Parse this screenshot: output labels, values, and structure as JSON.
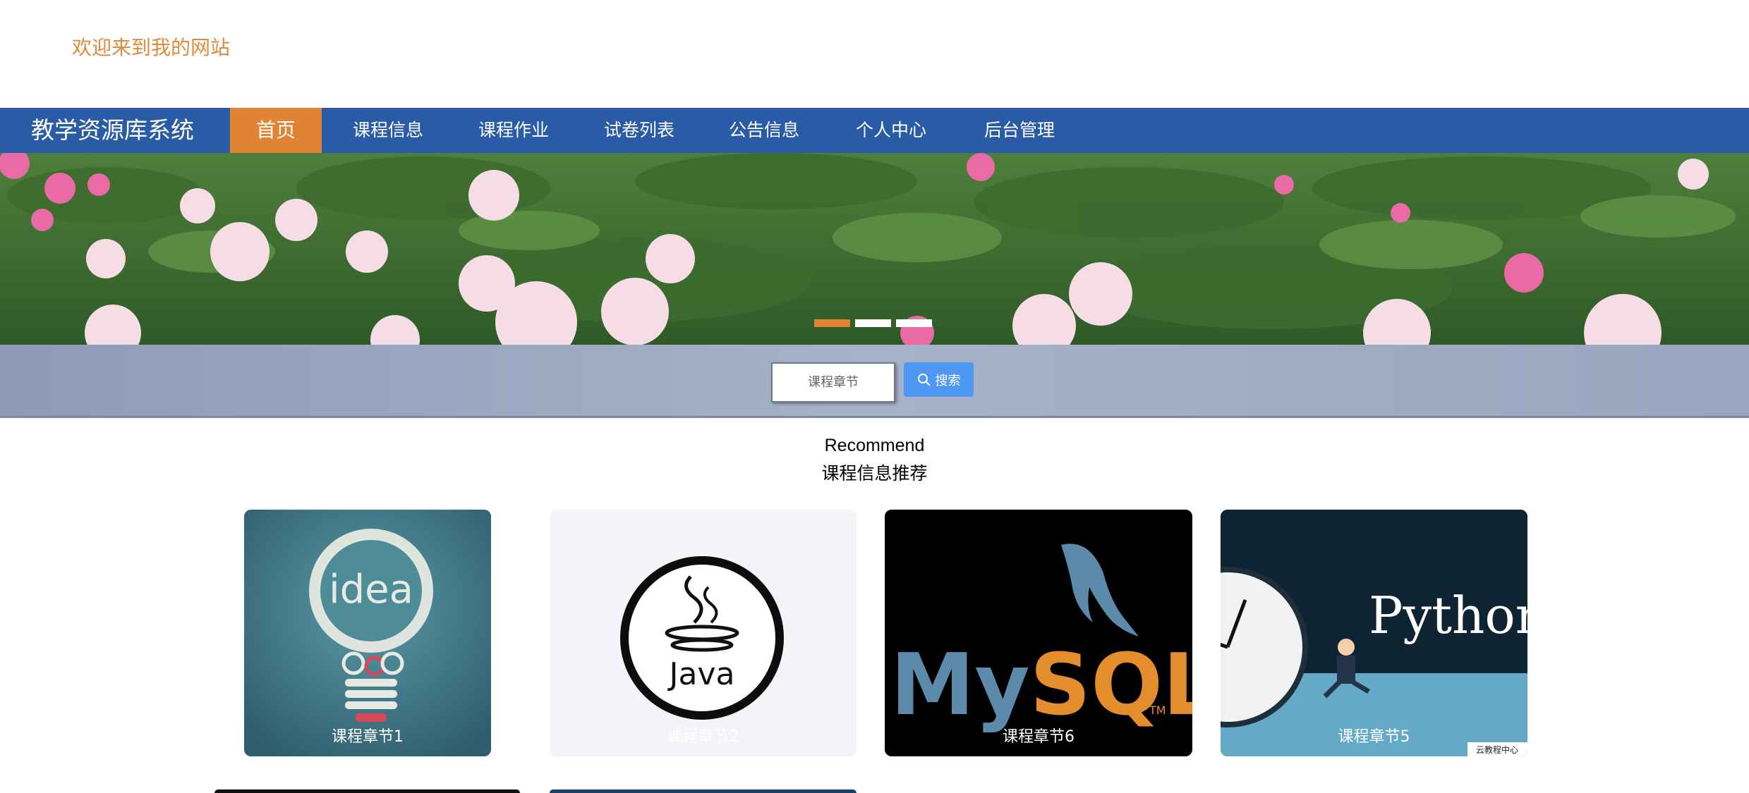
{
  "header": {
    "welcome": "欢迎来到我的网站"
  },
  "nav": {
    "brand": "教学资源库系统",
    "items": [
      "首页",
      "课程信息",
      "课程作业",
      "试卷列表",
      "公告信息",
      "个人中心",
      "后台管理"
    ],
    "active_index": 0
  },
  "banner": {
    "slide_count": 3,
    "active_slide": 0
  },
  "search": {
    "placeholder": "课程章节",
    "button_label": "搜索"
  },
  "recommend": {
    "title_en": "Recommend",
    "title_cn": "课程信息推荐",
    "cards": [
      {
        "title": "课程章节1",
        "image_text": "idea"
      },
      {
        "title": "课程章节2",
        "image_text": "Java"
      },
      {
        "title": "课程章节6",
        "image_text": "MySQL"
      },
      {
        "title": "课程章节5",
        "image_text": "Python",
        "watermark": "云教程中心"
      }
    ]
  },
  "colors": {
    "nav_bg": "#2a5ba6",
    "accent": "#e08434",
    "search_button": "#4d98f5",
    "welcome_text": "#e08a3a"
  }
}
